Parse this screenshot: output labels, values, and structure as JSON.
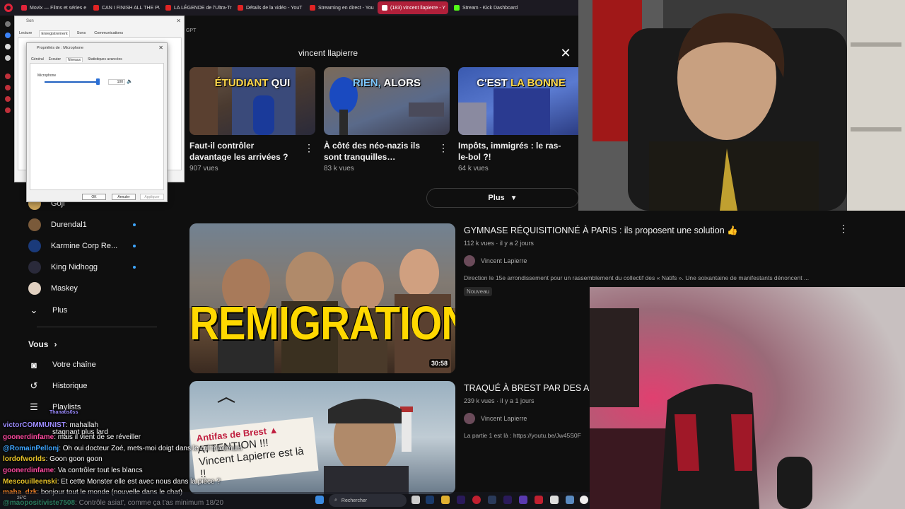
{
  "browser": {
    "tabs": [
      {
        "label": "Movix — Films et séries e",
        "color": "#e0243a"
      },
      {
        "label": "CAN I FINISH ALL THE PU",
        "color": "#e02424"
      },
      {
        "label": "LA LÉGENDE de l'Ultra-Tr",
        "color": "#e02424"
      },
      {
        "label": "Détails de la vidéo - YouT",
        "color": "#e02424"
      },
      {
        "label": "Streaming en direct - You",
        "color": "#e02424"
      },
      {
        "label": "(183) vincent llapierre - Y",
        "color": "#ffffff",
        "active": true
      },
      {
        "label": "Stream - Kick Dashboard",
        "color": "#53fc18"
      }
    ],
    "bookmark_partial": "GPT"
  },
  "search": {
    "query": "vincent llapierre",
    "close_label": "✕"
  },
  "shorts": [
    {
      "caption_white": "",
      "caption_hl": "ÉTUDIANT",
      "caption_rest": " QUI",
      "title": "Faut-il contrôler davantage les arrivées ?",
      "views": "907 vues"
    },
    {
      "caption_white": "",
      "caption_hl": "RIEN,",
      "caption_rest": " ALORS",
      "title": "À côté des néo-nazis ils sont tranquilles…",
      "views": "83 k vues"
    },
    {
      "caption_white": "C'EST ",
      "caption_hl": "LA BONNE",
      "caption_rest": "",
      "title": "Impôts, immigrés : le ras-le-bol ?!",
      "views": "64 k vues"
    }
  ],
  "more_button": "Plus",
  "videos": [
    {
      "title": "GYMNASE RÉQUISITIONNÉ À PARIS : ils proposent une solution 👍",
      "meta": "112 k vues · il y a 2 jours",
      "channel": "Vincent Lapierre",
      "description": "Direction le 15e arrondissement pour un rassemblement du collectif des « Natifs ». Une soixantaine de manifestants dénoncent ...",
      "badge": "Nouveau",
      "duration": "30:58",
      "thumb_text": "REMIGRATION"
    },
    {
      "title": "TRAQUÉ À BREST PAR DES ANTIFAS",
      "meta": "239 k vues · il y a 1 jours",
      "channel": "Vincent Lapierre",
      "description": "La partie 1 est là : https://youtu.be/Jw45S0F",
      "badge": "",
      "duration": "",
      "thumb_text_1": "Antifas de Brest ▲",
      "thumb_text_2": "ATTENTION !!!",
      "thumb_text_3": "Vincent Lapierre est là !!"
    }
  ],
  "sidebar": {
    "channels": [
      {
        "name": "Goji",
        "live": false,
        "color": "#c9a35a"
      },
      {
        "name": "Durendal1",
        "live": true,
        "color": "#7a5a3a"
      },
      {
        "name": "Karmine Corp Re...",
        "live": true,
        "color": "#1a3a7a"
      },
      {
        "name": "King Nidhogg",
        "live": true,
        "color": "#2a2a3a"
      },
      {
        "name": "Maskey",
        "live": false,
        "color": "#e0d0c0"
      }
    ],
    "more": "Plus",
    "you_section": "Vous",
    "items": [
      {
        "label": "Votre chaîne",
        "icon": "channel-icon"
      },
      {
        "label": "Historique",
        "icon": "history-icon"
      },
      {
        "label": "Playlists",
        "icon": "playlist-icon"
      }
    ]
  },
  "sound_dialog": {
    "title": "Son",
    "tabs": [
      "Lecture",
      "Enregistrement",
      "Sons",
      "Communications"
    ],
    "selected_tab": 1
  },
  "mic_dialog": {
    "title": "Propriétés de : Microphone",
    "tabs": [
      "Général",
      "Écouter",
      "Niveaux",
      "Statistiques avancées"
    ],
    "selected_tab": 2,
    "slider_label": "Microphone",
    "level": 100,
    "ok": "OK",
    "cancel": "Annuler",
    "apply": "Appliquer"
  },
  "chat": [
    {
      "user": "Thanatis0ss",
      "text": "",
      "color": "#9d8cff"
    },
    {
      "user": "victorCOMMUNIST",
      "text": "mahallah",
      "color": "#9d8cff"
    },
    {
      "user": "",
      "text": "stagnant plus lard",
      "color": "#ffffff"
    },
    {
      "user": "goonerdinfame",
      "text": "mais il vient de se réveiller",
      "color": "#ff4aa0"
    },
    {
      "user": "@RomainPellonj",
      "text": "Oh oui docteur Zoé, mets-moi doigt dans le cul maximum",
      "color": "#3ea6ff"
    },
    {
      "user": "lordofworlds",
      "text": "Goon goon goon",
      "color": "#e6c229"
    },
    {
      "user": "goonerdinfame",
      "text": "Va contrôler tout les blancs",
      "color": "#ff4aa0"
    },
    {
      "user": "Mescouilleenski",
      "text": "Et cette Monster elle est avec nous dans la pièce ?",
      "color": "#e6c229"
    },
    {
      "user": "maha_dzk",
      "text": "bonjour tout le monde (nouvelle dans le chat)",
      "color": "#ff8a2a"
    },
    {
      "user": "@maopositiviste7508",
      "text": "Contrôle asiat', comme ça t'as minimum 18/20",
      "color": "#3ef0a0"
    }
  ],
  "taskbar": {
    "search_placeholder": "Rechercher",
    "weather": "25°C"
  },
  "colors": {
    "background": "#0f0f0f",
    "youtube_text": "#f1f1f1",
    "muted": "#aaaaaa",
    "live_dot": "#3ea6ff",
    "active_tab": "#b0203a"
  }
}
